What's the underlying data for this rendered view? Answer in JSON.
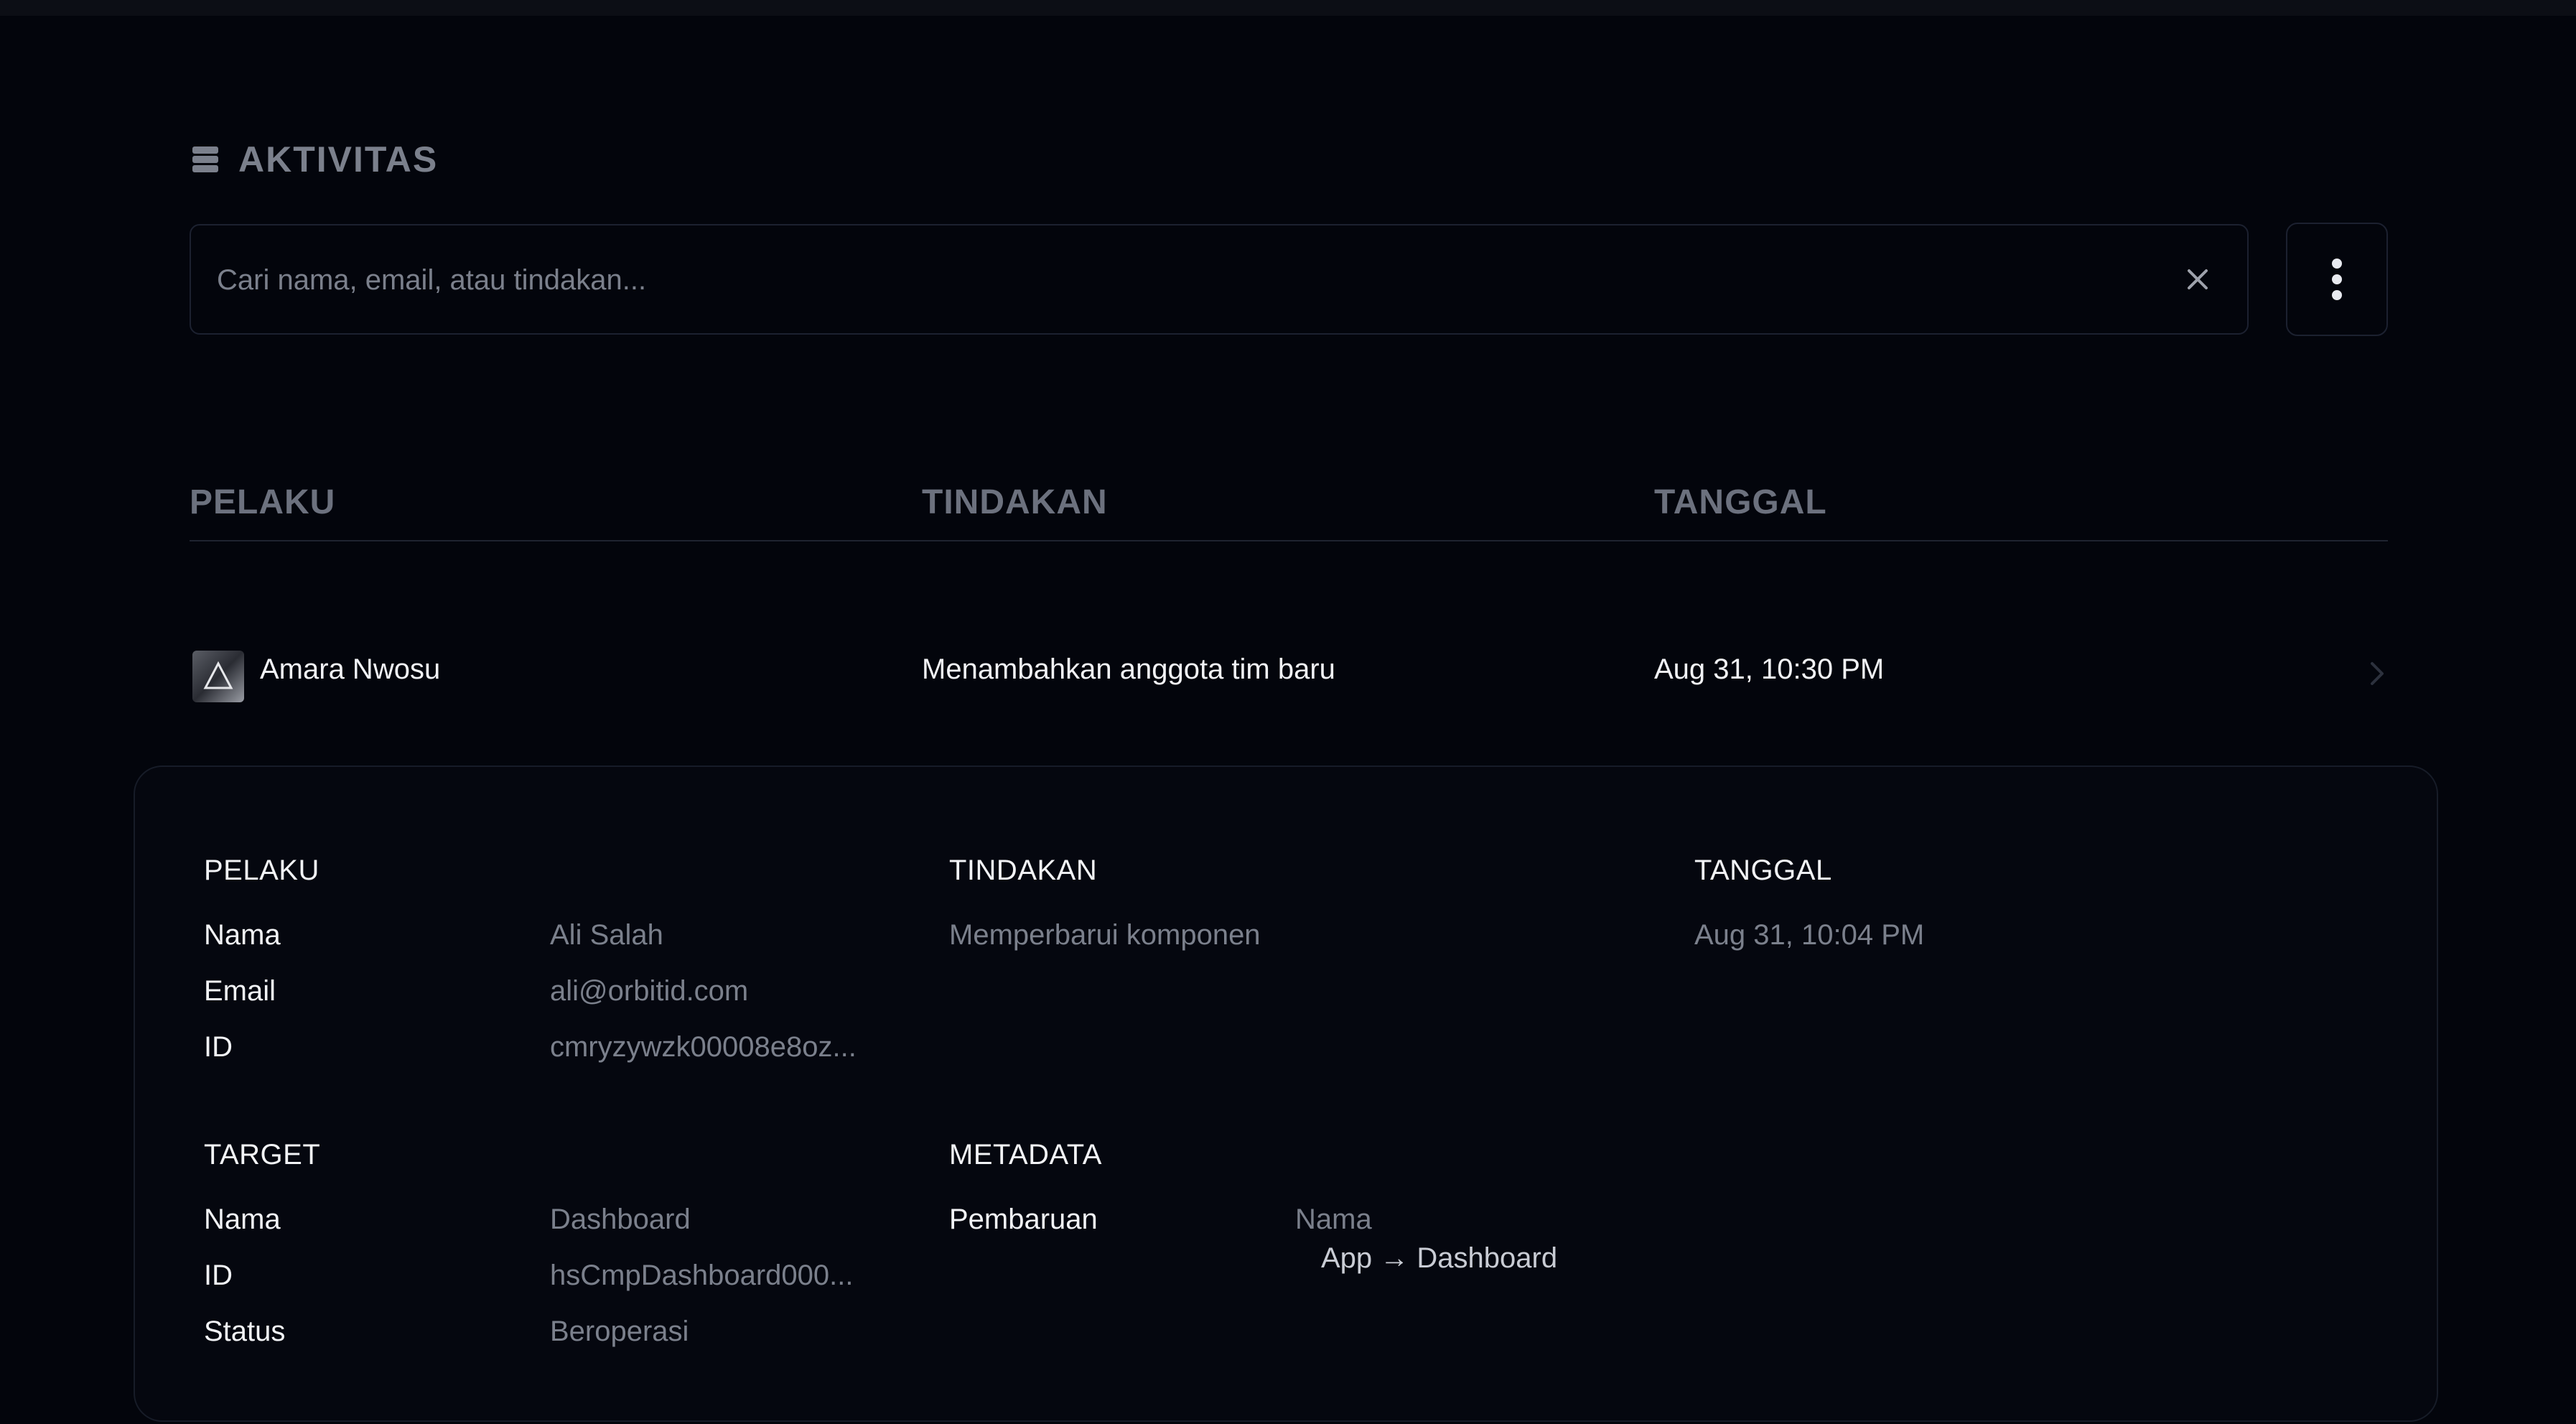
{
  "header": {
    "icon": "database-icon",
    "title": "AKTIVITAS"
  },
  "search": {
    "placeholder": "Cari nama, email, atau tindakan...",
    "value": "",
    "clear_icon": "close-icon"
  },
  "more_button": {
    "icon": "more-vertical-icon"
  },
  "table": {
    "columns": [
      "PELAKU",
      "TINDAKAN",
      "TANGGAL"
    ],
    "rows": [
      {
        "actor": "Amara Nwosu",
        "action": "Menambahkan anggota tim baru",
        "date": "Aug 31, 10:30 PM"
      }
    ]
  },
  "details": {
    "actor": {
      "title": "PELAKU",
      "fields": [
        {
          "key": "Nama",
          "value": "Ali Salah"
        },
        {
          "key": "Email",
          "value": "ali@orbitid.com"
        },
        {
          "key": "ID",
          "value": "cmryzywzk00008e8oz..."
        }
      ]
    },
    "action": {
      "title": "TINDAKAN",
      "value": "Memperbarui komponen"
    },
    "date": {
      "title": "TANGGAL",
      "value": "Aug 31, 10:04 PM"
    },
    "target": {
      "title": "TARGET",
      "fields": [
        {
          "key": "Nama",
          "value": "Dashboard"
        },
        {
          "key": "ID",
          "value": "hsCmpDashboard000..."
        },
        {
          "key": "Status",
          "value": "Beroperasi"
        }
      ]
    },
    "metadata": {
      "title": "METADATA",
      "key": "Pembaruan",
      "field": "Nama",
      "change": "App → Dashboard"
    }
  }
}
